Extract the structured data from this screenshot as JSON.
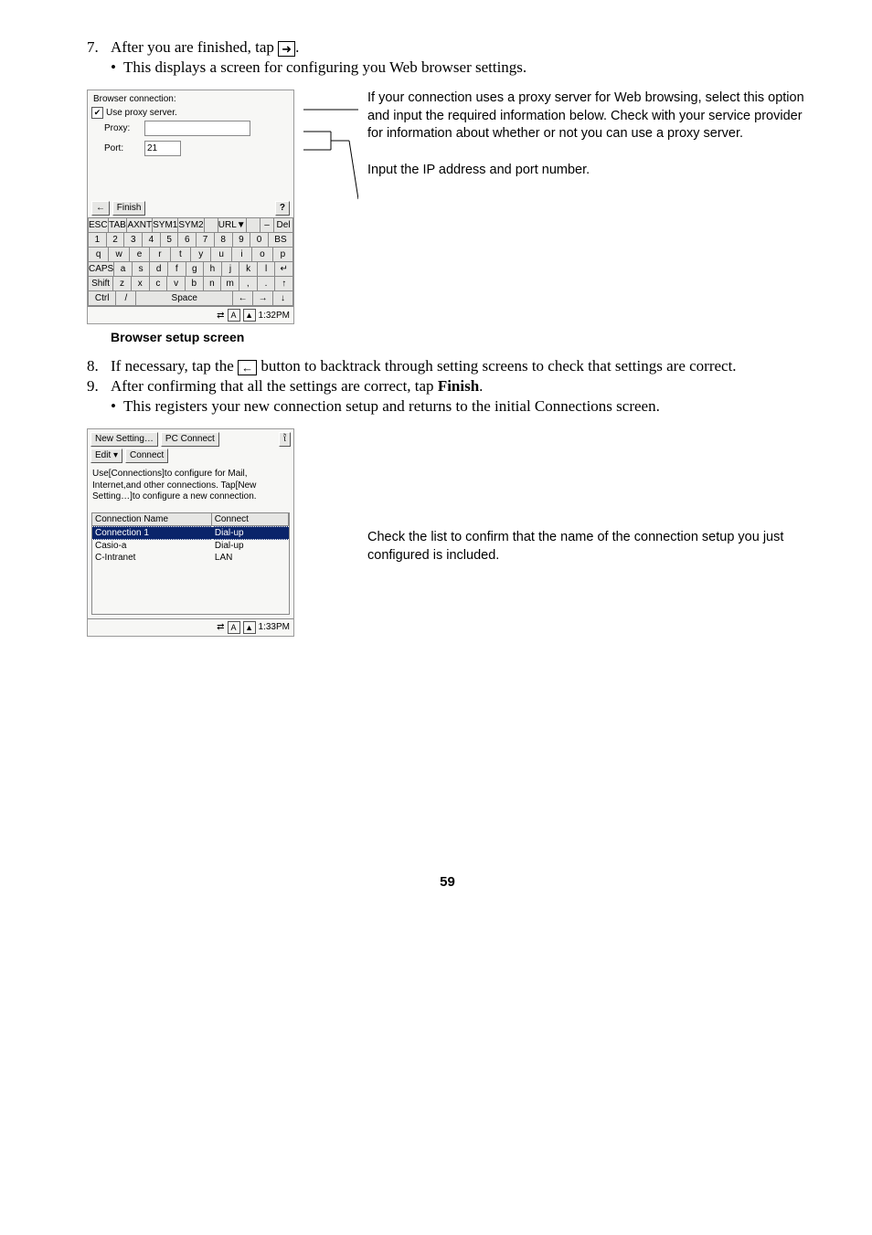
{
  "step7": {
    "num": "7.",
    "text_a": "After you are finished, tap ",
    "arrow": "➜",
    "text_b": "."
  },
  "step7_bullet": "This displays a screen for configuring you Web browser settings.",
  "scr1": {
    "title": "Browser connection:",
    "use_proxy_label": "Use proxy server.",
    "proxy_label": "Proxy:",
    "proxy_value": "",
    "port_label": "Port:",
    "port_value": "21",
    "back_arrow": "←",
    "finish": "Finish",
    "help": "?",
    "kbd": {
      "r1": [
        "ESC",
        "TAB",
        "AXNT",
        "SYM1",
        "SYM2",
        "",
        "URL▼",
        "",
        "–",
        "Del"
      ],
      "r2": [
        "1",
        "2",
        "3",
        "4",
        "5",
        "6",
        "7",
        "8",
        "9",
        "0",
        "BS"
      ],
      "r3": [
        "q",
        "w",
        "e",
        "r",
        "t",
        "y",
        "u",
        "i",
        "o",
        "p"
      ],
      "r4": [
        "CAPS",
        "a",
        "s",
        "d",
        "f",
        "g",
        "h",
        "j",
        "k",
        "l",
        "↵"
      ],
      "r5": [
        "Shift",
        "z",
        "x",
        "c",
        "v",
        "b",
        "n",
        "m",
        ",",
        ".",
        "↑"
      ],
      "r6": [
        "Ctrl",
        "/",
        "Space",
        "←",
        "→",
        "↓"
      ]
    },
    "statusbar": {
      "icons": [
        "⇄",
        "A",
        "▲"
      ],
      "time": "1:32PM"
    }
  },
  "annot1": "If your connection uses a proxy server for Web browsing, select this option and input the required information below. Check with your service provider for information about whether or not you can use a proxy server.",
  "annot2": "Input the IP address and port number.",
  "caption1": "Browser setup screen",
  "step8": {
    "num": "8.",
    "a": "If necessary, tap the ",
    "arrow": "←",
    "b": " button to backtrack through setting screens to check that settings are correct."
  },
  "step9": {
    "num": "9.",
    "a": "After confirming that all the settings are correct, tap ",
    "finish": "Finish",
    "b": "."
  },
  "step9_bullet": "This registers your new connection setup and returns to the initial Connections screen.",
  "scr2": {
    "new_setting": "New Setting…",
    "pc_connect": "PC Connect",
    "edit": "Edit ▾",
    "connect": "Connect",
    "info": "Use[Connections]to configure for Mail, Internet,and other connections. Tap[New Setting…]to configure a new connection.",
    "col1": "Connection Name",
    "col2": "Connect",
    "rows": [
      {
        "name": "Connection 1",
        "type": "Dial-up",
        "sel": true
      },
      {
        "name": "Casio-a",
        "type": "Dial-up",
        "sel": false
      },
      {
        "name": "C-Intranet",
        "type": "LAN",
        "sel": false
      }
    ],
    "help_icon": "?",
    "statusbar": {
      "icons": [
        "⇄",
        "A",
        "▲"
      ],
      "time": "1:33PM"
    }
  },
  "annot3": "Check the list to confirm that the name of the connection setup you just configured is included.",
  "page_number": "59"
}
